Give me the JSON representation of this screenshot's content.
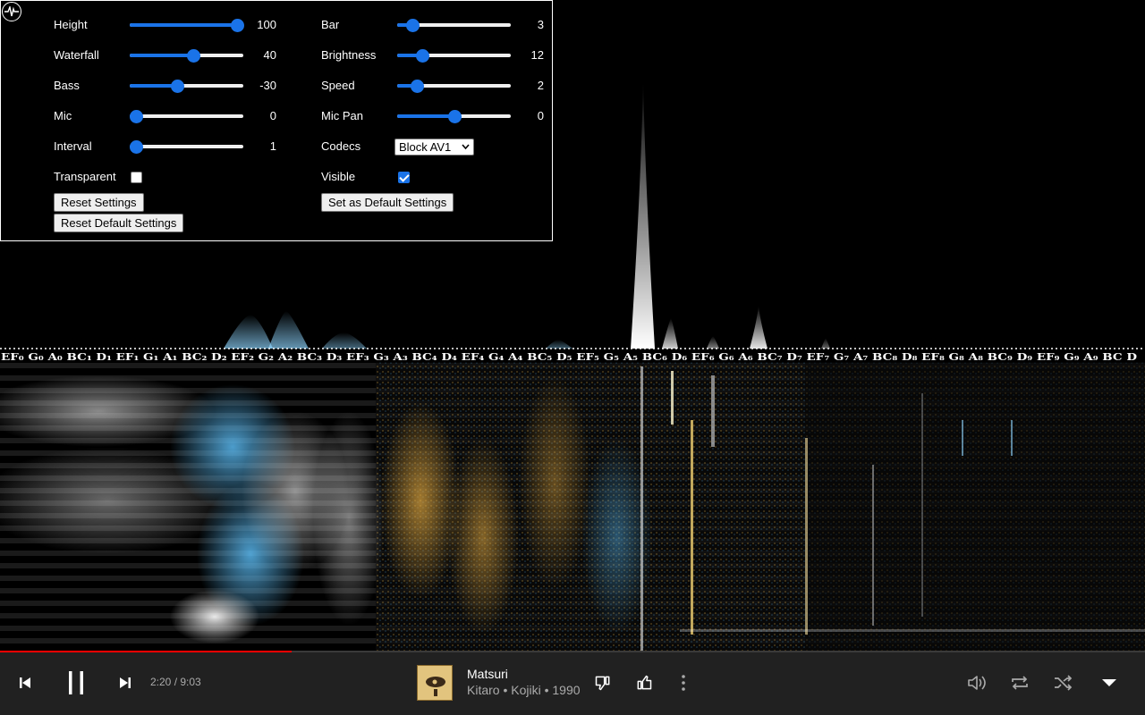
{
  "settings": {
    "left_column": [
      {
        "label": "Height",
        "value": "100",
        "level": 1.0
      },
      {
        "label": "Waterfall",
        "value": "40",
        "level": 0.57
      },
      {
        "label": "Bass",
        "value": "-30",
        "level": 0.41
      },
      {
        "label": "Mic",
        "value": "0",
        "level": 0.0
      },
      {
        "label": "Interval",
        "value": "1",
        "level": 0.0
      }
    ],
    "right_column": [
      {
        "label": "Bar",
        "value": "3",
        "level": 0.09
      },
      {
        "label": "Brightness",
        "value": "12",
        "level": 0.19
      },
      {
        "label": "Speed",
        "value": "2",
        "level": 0.13
      },
      {
        "label": "Mic Pan",
        "value": "0",
        "level": 0.5
      }
    ],
    "codecs": {
      "label": "Codecs",
      "selected": "Block AV1"
    },
    "transparent": {
      "label": "Transparent",
      "checked": false
    },
    "visible": {
      "label": "Visible",
      "checked": true
    },
    "buttons": {
      "reset": "Reset Settings",
      "reset_default": "Reset Default Settings",
      "set_default": "Set as Default Settings"
    }
  },
  "spectrum": {
    "note_labels": "EF₀ G₀ A₀ BC₁ D₁ EF₁ G₁ A₁ BC₂ D₂ EF₂ G₂ A₂ BC₃ D₃ EF₃ G₃ A₃ BC₄ D₄ EF₄ G₄ A₄ BC₅ D₅ EF₅ G₅ A₅ BC₆ D₆ EF₆ G₆ A₆ BC₇ D₇ EF₇ G₇ A₇ BC₈ D₈ EF₈ G₈ A₈ BC₉ D₉ EF₉ G₉ A₉ BC D"
  },
  "player": {
    "progress": 0.255,
    "time": "2:20 / 9:03",
    "title": "Matsuri",
    "subtitle": "Kitaro • Kojiki • 1990",
    "icons": {
      "prev": "skip-previous-icon",
      "pause": "pause-icon",
      "next": "skip-next-icon",
      "dislike": "thumb-down-icon",
      "like": "thumb-up-icon",
      "more": "more-vert-icon",
      "volume": "volume-icon",
      "repeat": "repeat-icon",
      "shuffle": "shuffle-icon",
      "expand": "expand-down-icon"
    }
  },
  "colors": {
    "accent": "#1a73e8",
    "progress": "#ff0000",
    "player_bg": "#212121"
  }
}
